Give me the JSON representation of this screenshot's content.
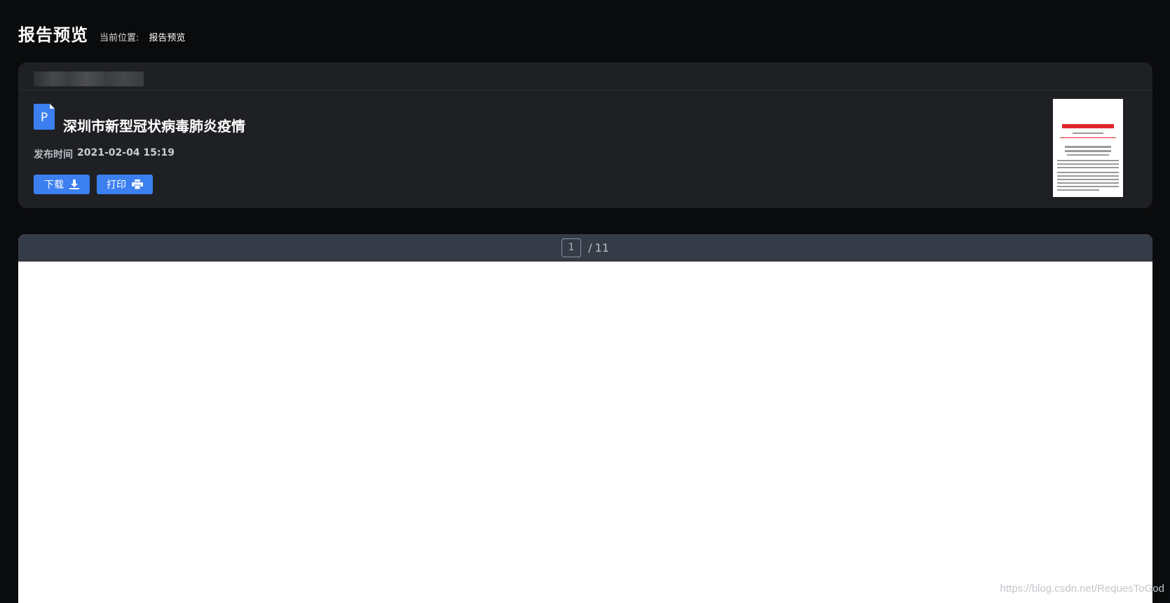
{
  "header": {
    "title": "报告预览",
    "breadcrumb_label": "当前位置:",
    "breadcrumb_current": "报告预览"
  },
  "report": {
    "file_type_letter": "P",
    "title": "深圳市新型冠状病毒肺炎疫情",
    "publish_label": "发布时间",
    "publish_time": "2021-02-04 15:19",
    "download_label": "下载",
    "print_label": "打印",
    "icons": {
      "file": "pdf-file-icon",
      "download": "download-icon",
      "print": "printer-icon"
    }
  },
  "viewer": {
    "current_page": "1",
    "separator": "/",
    "total_pages": "11"
  },
  "watermark": "https://blog.csdn.net/RequesToGod",
  "colors": {
    "background": "#0a0b0c",
    "card": "#1f2024",
    "accent": "#3b7ff0",
    "viewer_bar": "#363c47"
  }
}
